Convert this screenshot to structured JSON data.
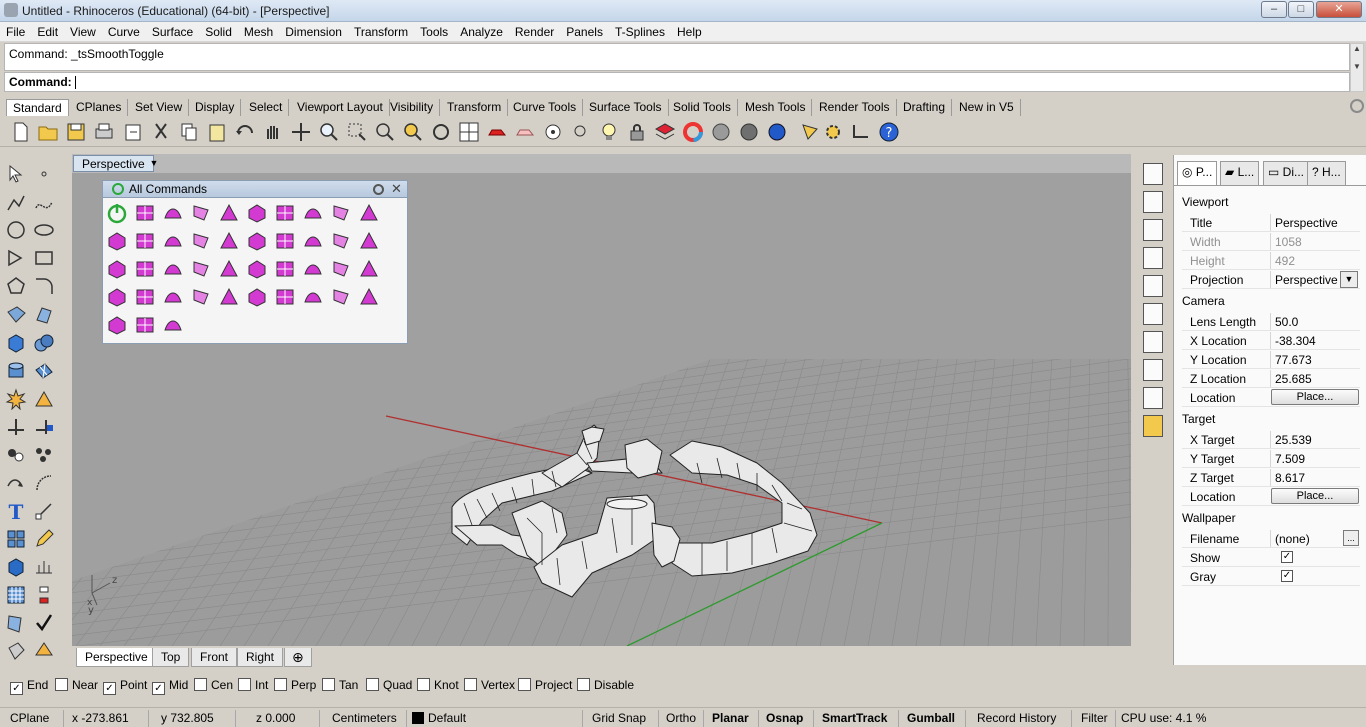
{
  "window": {
    "title": "Untitled - Rhinoceros (Educational) (64-bit) - [Perspective]"
  },
  "menu": [
    "File",
    "Edit",
    "View",
    "Curve",
    "Surface",
    "Solid",
    "Mesh",
    "Dimension",
    "Transform",
    "Tools",
    "Analyze",
    "Render",
    "Panels",
    "T-Splines",
    "Help"
  ],
  "command": {
    "history": "Command: _tsSmoothToggle",
    "prompt": "Command:"
  },
  "toolbar_tabs": [
    "Standard",
    "CPlanes",
    "Set View",
    "Display",
    "Select",
    "Viewport Layout",
    "Visibility",
    "Transform",
    "Curve Tools",
    "Surface Tools",
    "Solid Tools",
    "Mesh Tools",
    "Render Tools",
    "Drafting",
    "New in V5"
  ],
  "viewport": {
    "title": "Perspective",
    "tabs": [
      "Perspective",
      "Top",
      "Front",
      "Right"
    ],
    "axis_labels": {
      "z": "z",
      "y": "y",
      "x": "x"
    }
  },
  "all_commands": {
    "title": "All Commands"
  },
  "properties": {
    "tabs": [
      "P...",
      "L...",
      "Di...",
      "H..."
    ],
    "viewport_section": "Viewport",
    "title_label": "Title",
    "title_value": "Perspective",
    "width_label": "Width",
    "width_value": "1058",
    "height_label": "Height",
    "height_value": "492",
    "projection_label": "Projection",
    "projection_value": "Perspective",
    "camera_section": "Camera",
    "lens_label": "Lens Length",
    "lens_value": "50.0",
    "xloc_label": "X Location",
    "xloc_value": "-38.304",
    "yloc_label": "Y Location",
    "yloc_value": "77.673",
    "zloc_label": "Z Location",
    "zloc_value": "25.685",
    "location_label": "Location",
    "place_button": "Place...",
    "target_section": "Target",
    "xt_label": "X Target",
    "xt_value": "25.539",
    "yt_label": "Y Target",
    "yt_value": "7.509",
    "zt_label": "Z Target",
    "zt_value": "8.617",
    "tloc_label": "Location",
    "tplace_button": "Place...",
    "wallpaper_section": "Wallpaper",
    "filename_label": "Filename",
    "filename_value": "(none)",
    "show_label": "Show",
    "gray_label": "Gray"
  },
  "osnaps": [
    {
      "label": "End",
      "checked": true
    },
    {
      "label": "Near",
      "checked": false
    },
    {
      "label": "Point",
      "checked": true
    },
    {
      "label": "Mid",
      "checked": true
    },
    {
      "label": "Cen",
      "checked": false
    },
    {
      "label": "Int",
      "checked": false
    },
    {
      "label": "Perp",
      "checked": false
    },
    {
      "label": "Tan",
      "checked": false
    },
    {
      "label": "Quad",
      "checked": false
    },
    {
      "label": "Knot",
      "checked": false
    },
    {
      "label": "Vertex",
      "checked": false
    },
    {
      "label": "Project",
      "checked": false
    },
    {
      "label": "Disable",
      "checked": false
    }
  ],
  "status": {
    "cplane": "CPlane",
    "x": "x -273.861",
    "y": "y 732.805",
    "z": "z 0.000",
    "units": "Centimeters",
    "layer": "Default",
    "grid_snap": "Grid Snap",
    "ortho": "Ortho",
    "planar": "Planar",
    "osnap": "Osnap",
    "smarttrack": "SmartTrack",
    "gumball": "Gumball",
    "record_history": "Record History",
    "filter": "Filter",
    "cpu": "CPU use: 4.1 %"
  },
  "colors": {
    "viewport_bg": "#a0a0a0",
    "x_axis": "#b03030",
    "y_axis": "#2f9a2f",
    "accent_magenta": "#d23ad2"
  }
}
